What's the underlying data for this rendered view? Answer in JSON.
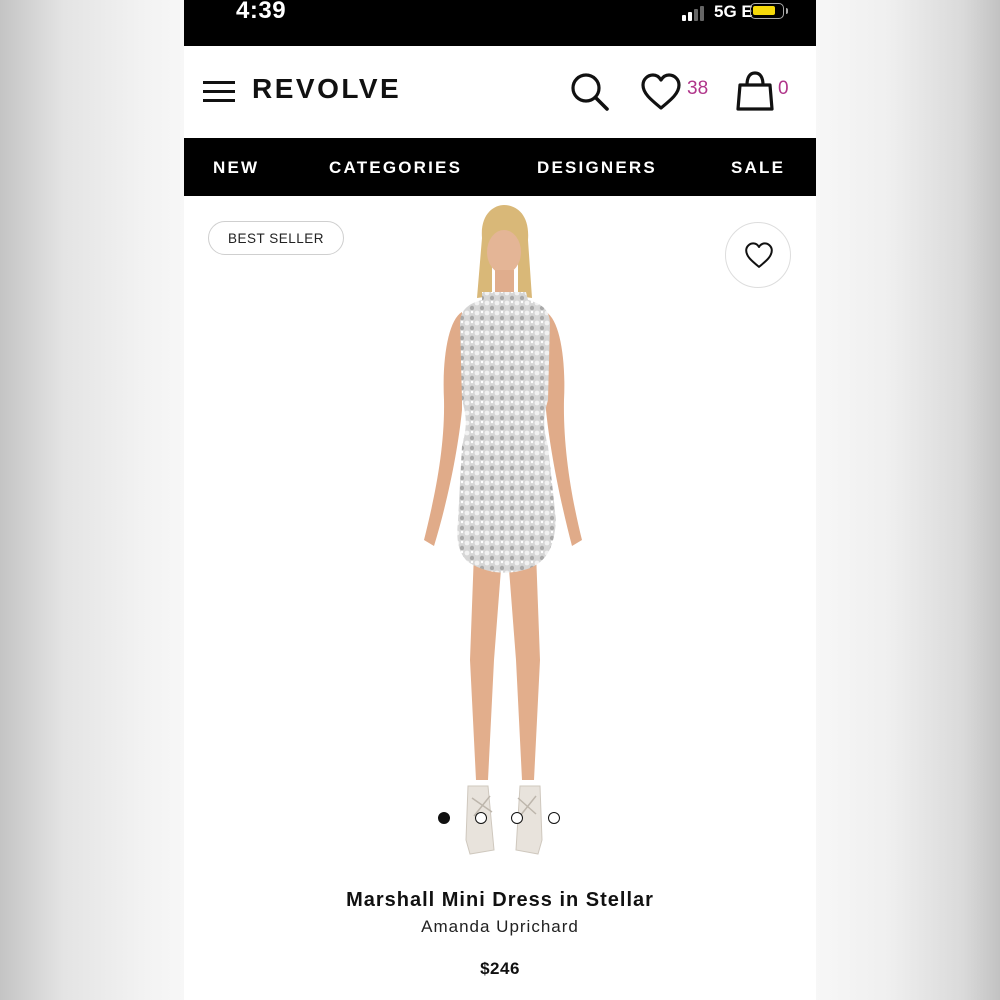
{
  "status_bar": {
    "time": "4:39",
    "network": "5G E",
    "battery_level": 0.85,
    "signal_bars": 4,
    "signal_active": 2,
    "battery_color": "#f5d90a"
  },
  "header": {
    "logo": "REVOLVE",
    "wishlist_count": "38",
    "bag_count": "0",
    "accent_color": "#b0358a"
  },
  "nav": {
    "items": [
      "NEW",
      "CATEGORIES",
      "DESIGNERS",
      "SALE"
    ]
  },
  "product": {
    "badge": "BEST SELLER",
    "name": "Marshall Mini Dress in Stellar",
    "designer": "Amanda Uprichard",
    "price": "$246",
    "image_count": 4,
    "active_image": 1
  }
}
